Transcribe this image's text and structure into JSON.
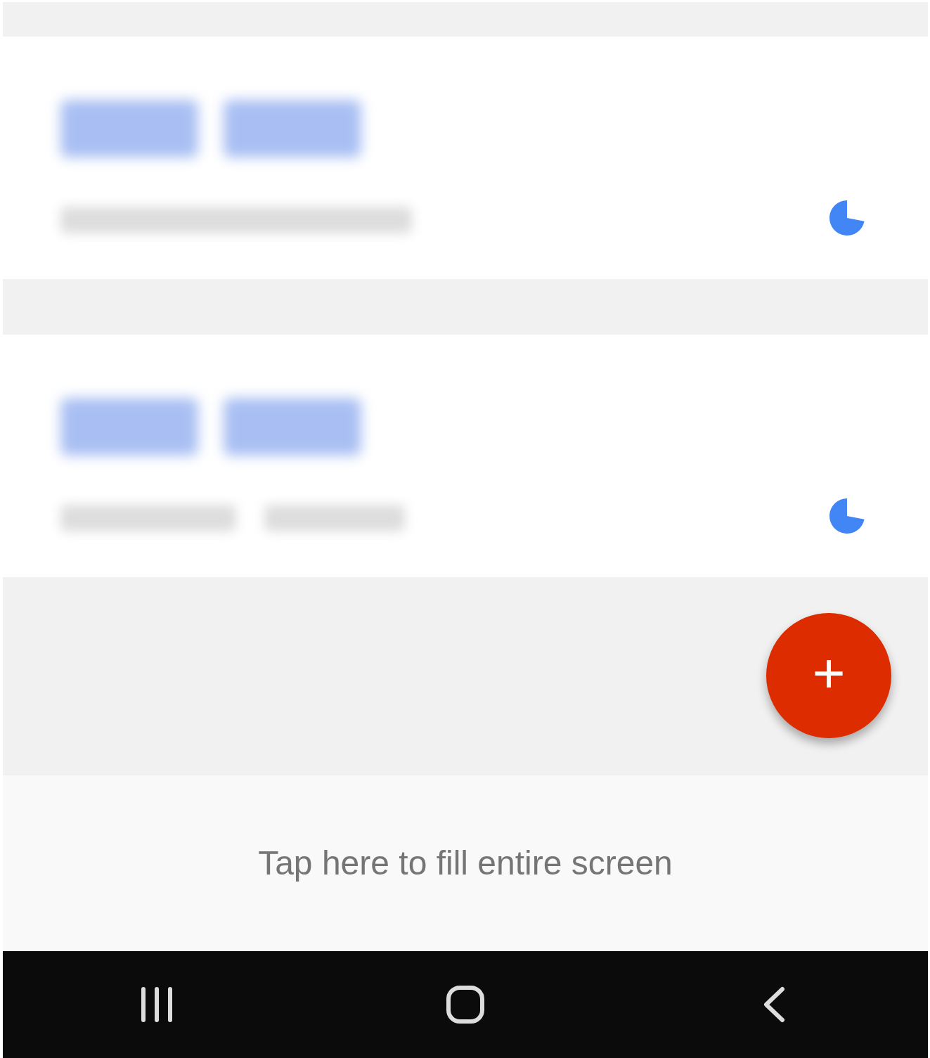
{
  "accounts": [
    {
      "kind": "account"
    },
    {
      "kind": "account"
    }
  ],
  "add_button": {
    "label": "+"
  },
  "footer": {
    "text": "Tap here to fill entire screen"
  }
}
